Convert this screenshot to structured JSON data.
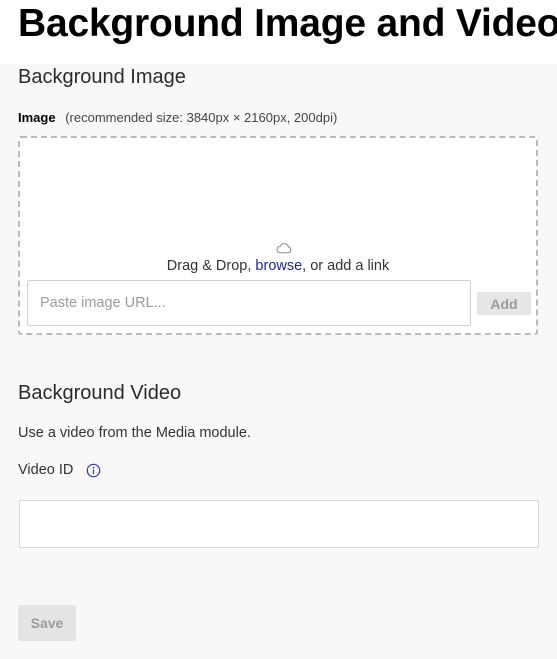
{
  "page": {
    "title": "Background Image and Video"
  },
  "background_image": {
    "section_title": "Background Image",
    "field_label": "Image",
    "field_hint": "(recommended size: 3840px × 2160px, 200dpi)",
    "drop_text_before": "Drag & Drop, ",
    "browse_label": "browse",
    "drop_text_after": ", or add a link",
    "url_input": {
      "value": "",
      "placeholder": "Paste image URL..."
    },
    "add_label": "Add",
    "icon": "cloud-icon"
  },
  "background_video": {
    "section_title": "Background Video",
    "description": "Use a video from the Media module.",
    "video_id_label": "Video ID",
    "info_icon": "info-icon",
    "video_id_input": {
      "value": "",
      "placeholder": ""
    }
  },
  "footer": {
    "save_label": "Save"
  },
  "colors": {
    "link": "#1d2a8a",
    "button_disabled_bg": "#e6e6e6",
    "button_disabled_text": "#9b9b9b",
    "page_background": "#f8f8f8"
  }
}
